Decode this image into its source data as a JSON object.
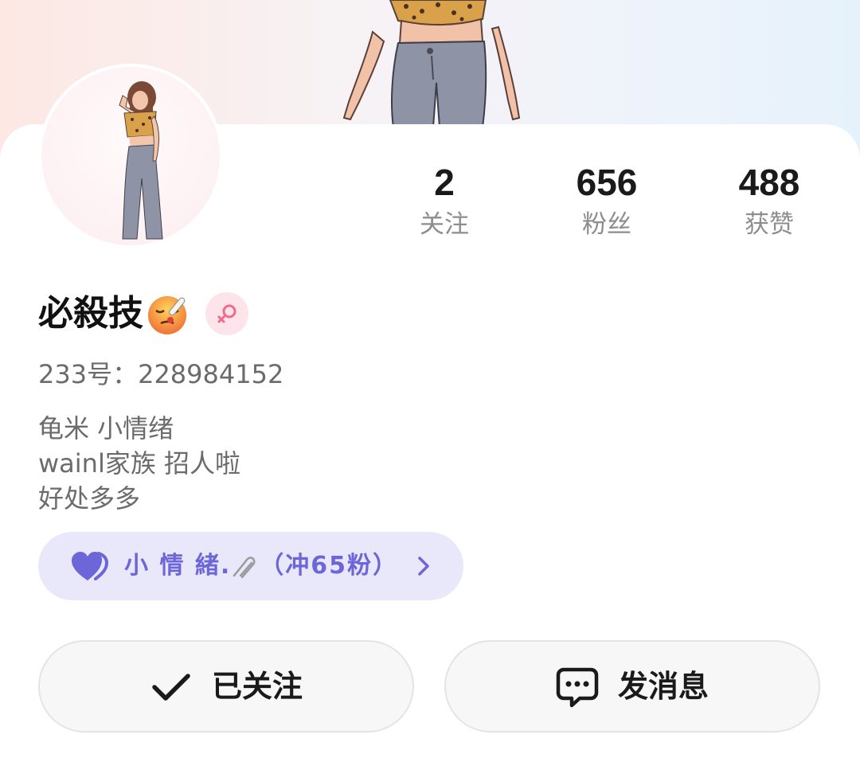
{
  "profile": {
    "name": "必殺技",
    "name_emoji": "face-with-thermometer-emoji",
    "gender": "female",
    "uid": "233号：228984152",
    "bio": [
      "龟米 小情绪",
      "wainl家族 招人啦",
      "好处多多"
    ]
  },
  "stats": [
    {
      "value": "2",
      "label": "关注"
    },
    {
      "value": "656",
      "label": "粉丝"
    },
    {
      "value": "488",
      "label": "获赞"
    }
  ],
  "tag": {
    "text": "小 情 緒.",
    "suffix": "（冲65粉）",
    "icon": "heart-icon",
    "clip_icon": "paperclip-icon",
    "color": "#6d66d8",
    "background": "#e9e8fb"
  },
  "actions": {
    "follow_label": "已关注",
    "message_label": "发消息"
  },
  "colors": {
    "gender_bg": "#fde4ea",
    "gender_fg": "#f06a8a"
  }
}
